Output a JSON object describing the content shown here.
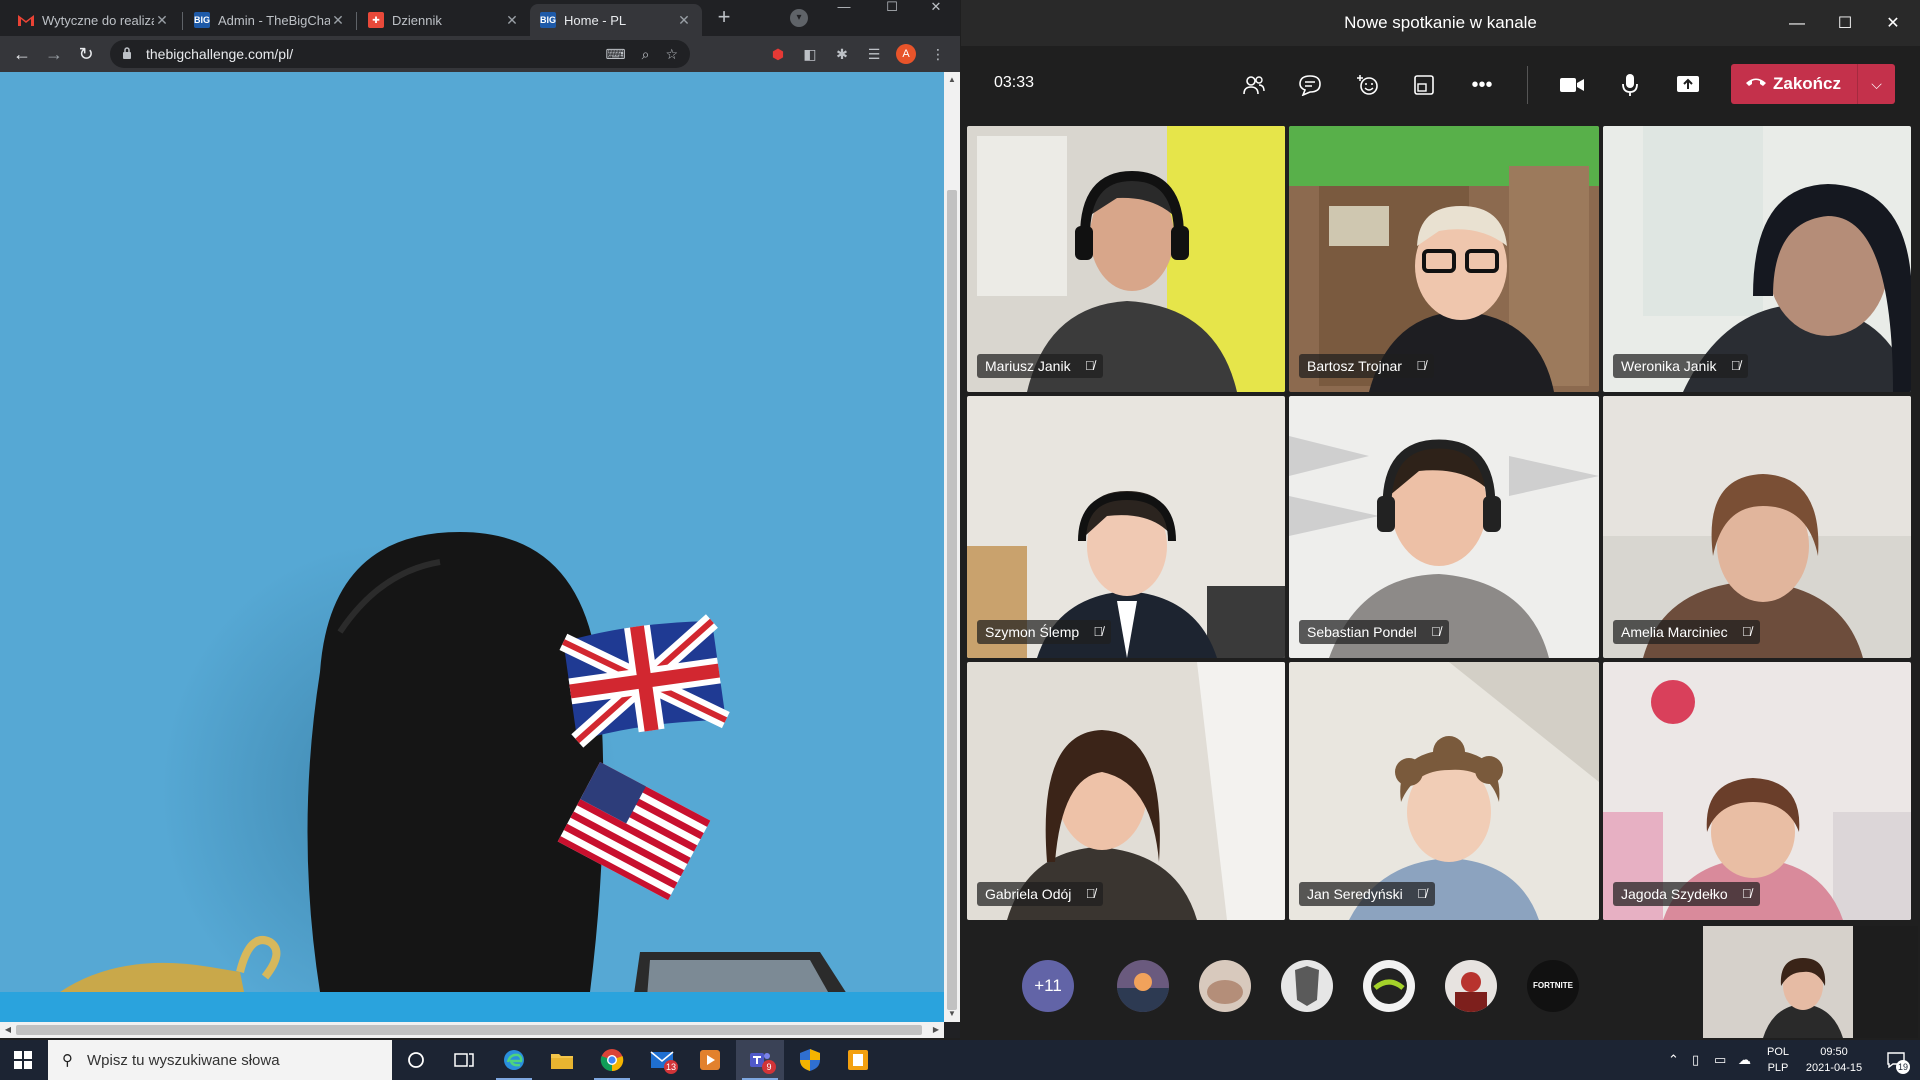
{
  "browser": {
    "tabs": [
      {
        "favicon": "gmail-icon",
        "title": "Wytyczne do realizac",
        "active": false
      },
      {
        "favicon": "big-icon",
        "title": "Admin - TheBigChalle",
        "active": false
      },
      {
        "favicon": "dziennik-icon",
        "title": "Dziennik",
        "active": false
      },
      {
        "favicon": "big-icon",
        "title": "Home - PL",
        "active": true
      }
    ],
    "new_tab": "+",
    "url": "thebigchallenge.com/pl/",
    "profile_initial": "A"
  },
  "teams": {
    "window_title": "Nowe spotkanie w kanale",
    "timer": "03:33",
    "end_call_label": "Zakończ",
    "participants": [
      {
        "name": "Mariusz Janik"
      },
      {
        "name": "Bartosz Trojnar"
      },
      {
        "name": "Weronika Janik"
      },
      {
        "name": "Szymon Ślemp"
      },
      {
        "name": "Sebastian Pondel"
      },
      {
        "name": "Amelia Marciniec"
      },
      {
        "name": "Gabriela Odój"
      },
      {
        "name": "Jan Seredyński"
      },
      {
        "name": "Jagoda Szydełko"
      }
    ],
    "overflow_count": "+11",
    "avatar_text_fortnite": "FORTNITE"
  },
  "taskbar": {
    "search_placeholder": "Wpisz tu wyszukiwane słowa",
    "mail_badge": "13",
    "teams_badge": "9",
    "lang_line1": "POL",
    "lang_line2": "PLP",
    "time": "09:50",
    "date": "2021-04-15",
    "notification_count": "19"
  },
  "colors": {
    "page_blue": "#56a8d4",
    "teams_end_call": "#c4314b",
    "teams_overflow": "#6264a7"
  }
}
